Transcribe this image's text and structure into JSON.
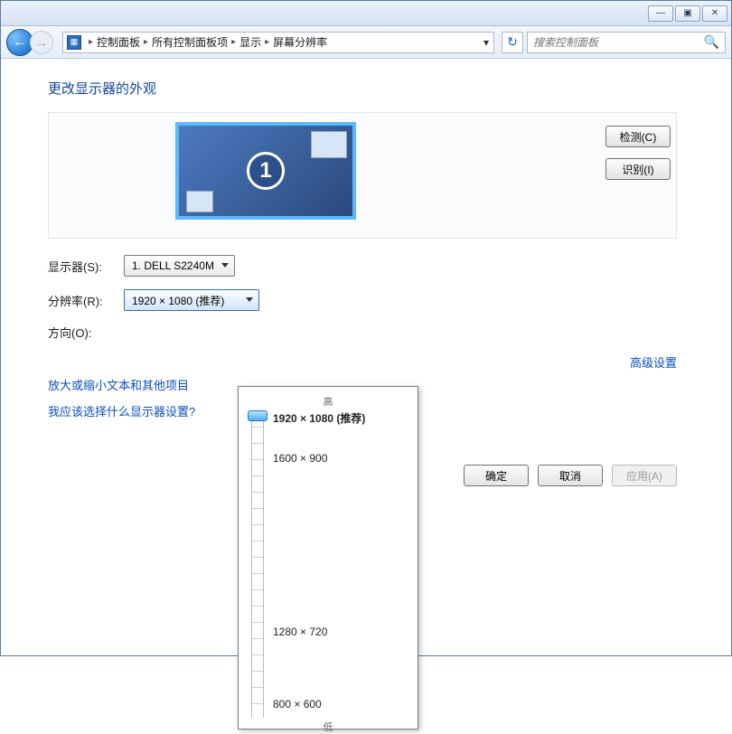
{
  "window_controls": {
    "min": "—",
    "max": "▣",
    "close": "✕"
  },
  "breadcrumb": {
    "items": [
      "控制面板",
      "所有控制面板项",
      "显示",
      "屏幕分辨率"
    ]
  },
  "search": {
    "placeholder": "搜索控制面板"
  },
  "page_title": "更改显示器的外观",
  "monitor_number": "1",
  "side_buttons": {
    "detect": "检测(C)",
    "identify": "识别(I)"
  },
  "form": {
    "display_label": "显示器(S):",
    "display_value": "1. DELL S2240M",
    "resolution_label": "分辨率(R):",
    "resolution_value": "1920 × 1080 (推荐)",
    "orientation_label": "方向(O):"
  },
  "links": {
    "advanced": "高级设置",
    "text_size": "放大或缩小文本和其他项目",
    "which": "我应该选择什么显示器设置?"
  },
  "buttons": {
    "ok": "确定",
    "cancel": "取消",
    "apply": "应用(A)"
  },
  "dropdown": {
    "top_label": "高",
    "bot_label": "低",
    "options": [
      {
        "label": "1920 × 1080 (推荐)",
        "pos": 0,
        "bold": true
      },
      {
        "label": "1600 × 900",
        "pos": 46
      },
      {
        "label": "1280 × 720",
        "pos": 238
      },
      {
        "label": "800 × 600",
        "pos": 318
      }
    ]
  }
}
